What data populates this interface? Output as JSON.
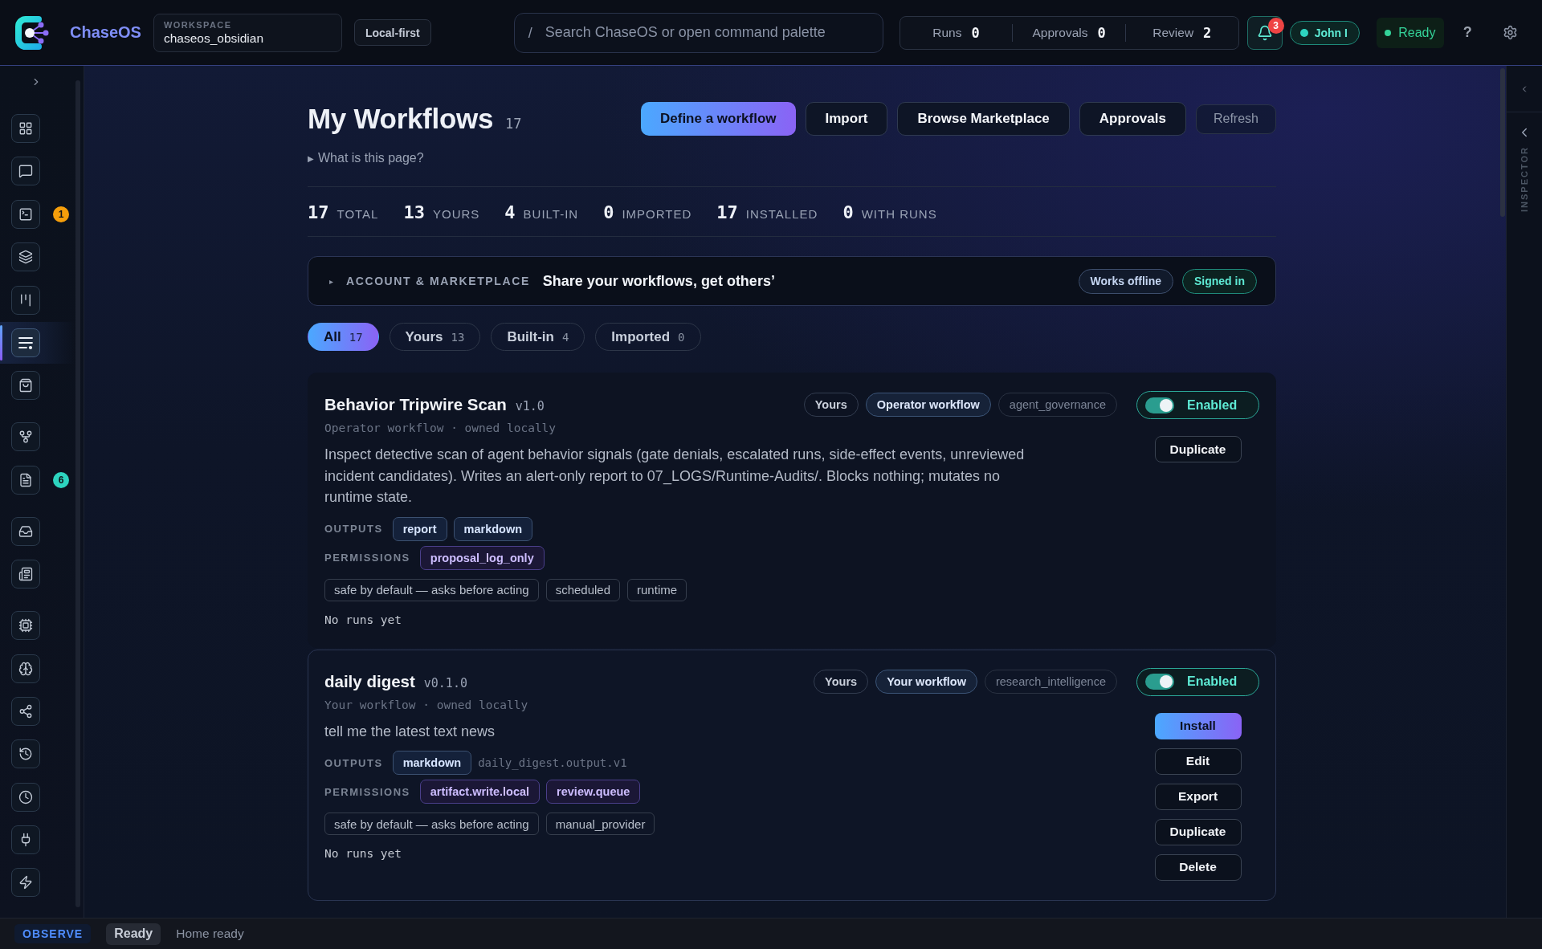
{
  "topbar": {
    "brand": "ChaseOS",
    "workspace": {
      "label": "WORKSPACE",
      "value": "chaseos_obsidian"
    },
    "mode": "Local-first",
    "search": {
      "shortcut": "/",
      "placeholder": "Search ChaseOS or open command palette"
    },
    "counters": [
      {
        "label": "Runs",
        "value": "0"
      },
      {
        "label": "Approvals",
        "value": "0"
      },
      {
        "label": "Review",
        "value": "2"
      }
    ],
    "notifications": {
      "count": "3"
    },
    "user": {
      "name": "John I"
    },
    "status": "Ready",
    "help": "?"
  },
  "sidebar": {
    "groups": [
      [
        {
          "selected": false
        },
        {
          "selected": false
        },
        {
          "selected": false,
          "badge": "1",
          "color": "#f59e0b"
        },
        {
          "selected": false
        },
        {
          "selected": false
        },
        {
          "selected": true
        },
        {
          "selected": false
        }
      ],
      [
        {
          "selected": false
        },
        {
          "selected": false,
          "badge": "6",
          "color": "#2dd4bf"
        }
      ],
      [
        {
          "selected": false
        },
        {
          "selected": false
        }
      ],
      [
        {
          "selected": false
        },
        {
          "selected": false
        },
        {
          "selected": false
        },
        {
          "selected": false
        },
        {
          "selected": false
        },
        {
          "selected": false
        },
        {
          "selected": false
        }
      ]
    ]
  },
  "page": {
    "title": "My Workflows",
    "count": "17",
    "actions": [
      {
        "label": "Define a workflow",
        "kind": "primary"
      },
      {
        "label": "Import",
        "kind": "secondary"
      },
      {
        "label": "Browse Marketplace",
        "kind": "secondary"
      },
      {
        "label": "Approvals",
        "kind": "secondary"
      },
      {
        "label": "Refresh",
        "kind": "ghost"
      }
    ],
    "help": {
      "glyph": "▶",
      "label": "What is this page?"
    },
    "stats": [
      {
        "value": "17",
        "label": "TOTAL"
      },
      {
        "value": "13",
        "label": "YOURS"
      },
      {
        "value": "4",
        "label": "BUILT-IN"
      },
      {
        "value": "0",
        "label": "IMPORTED"
      },
      {
        "value": "17",
        "label": "INSTALLED"
      },
      {
        "value": "0",
        "label": "WITH RUNS"
      }
    ],
    "account": {
      "glyph": "▸",
      "label": "ACCOUNT & MARKETPLACE",
      "headline": "Share your workflows, get others’",
      "chips": [
        {
          "label": "Works offline",
          "kind": "info"
        },
        {
          "label": "Signed in",
          "kind": "success"
        }
      ]
    },
    "filters": [
      {
        "label": "All",
        "count": "17",
        "selected": true
      },
      {
        "label": "Yours",
        "count": "13",
        "selected": false
      },
      {
        "label": "Built-in",
        "count": "4",
        "selected": false
      },
      {
        "label": "Imported",
        "count": "0",
        "selected": false
      }
    ]
  },
  "workflows": [
    {
      "title": "Behavior Tripwire Scan",
      "version": "v1.0",
      "selected": false,
      "tags": [
        {
          "label": "Yours",
          "kind": "owner"
        },
        {
          "label": "Operator workflow",
          "kind": "type"
        },
        {
          "label": "agent_governance",
          "kind": "domain"
        }
      ],
      "toggle": {
        "label": "Enabled",
        "on": true
      },
      "meta": "Operator workflow · owned locally",
      "description": "Inspect detective scan of agent behavior signals (gate denials, escalated runs, side-effect events, unreviewed incident candidates). Writes an alert-only report to 07_LOGS/Runtime-Audits/. Blocks nothing; mutates no runtime state.",
      "outputs": {
        "label": "OUTPUTS",
        "items": [
          {
            "label": "report",
            "kind": "chip"
          },
          {
            "label": "markdown",
            "kind": "chip"
          }
        ]
      },
      "permissions": {
        "label": "PERMISSIONS",
        "items": [
          "proposal_log_only"
        ]
      },
      "traits": [
        "safe by default — asks before acting",
        "scheduled",
        "runtime"
      ],
      "runs": "No runs yet",
      "actions": [
        {
          "label": "Duplicate",
          "kind": "secondary"
        }
      ]
    },
    {
      "title": "daily digest",
      "version": "v0.1.0",
      "selected": true,
      "tags": [
        {
          "label": "Yours",
          "kind": "owner"
        },
        {
          "label": "Your workflow",
          "kind": "type"
        },
        {
          "label": "research_intelligence",
          "kind": "domain"
        }
      ],
      "toggle": {
        "label": "Enabled",
        "on": true
      },
      "meta": "Your workflow · owned locally",
      "description": "tell me the latest text news",
      "outputs": {
        "label": "OUTPUTS",
        "items": [
          {
            "label": "markdown",
            "kind": "chip"
          },
          {
            "label": "daily_digest.output.v1",
            "kind": "schema"
          }
        ]
      },
      "permissions": {
        "label": "PERMISSIONS",
        "items": [
          "artifact.write.local",
          "review.queue"
        ]
      },
      "traits": [
        "safe by default — asks before acting",
        "manual_provider"
      ],
      "runs": "No runs yet",
      "actions": [
        {
          "label": "Install",
          "kind": "primary"
        },
        {
          "label": "Edit",
          "kind": "secondary"
        },
        {
          "label": "Export",
          "kind": "secondary"
        },
        {
          "label": "Duplicate",
          "kind": "secondary"
        },
        {
          "label": "Delete",
          "kind": "secondary"
        }
      ]
    }
  ],
  "inspector": {
    "label": "INSPECTOR"
  },
  "status_bar": {
    "mode": "OBSERVE",
    "state": "Ready",
    "message": "Home ready"
  }
}
